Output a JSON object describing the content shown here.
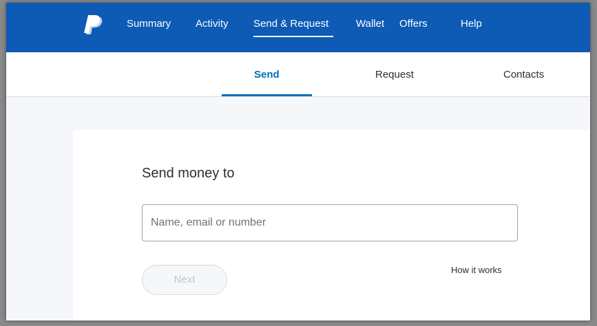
{
  "theme": {
    "nav_bg": "#0d5bb5",
    "accent": "#0070ba",
    "page_bg": "#f5f7fa"
  },
  "topnav": {
    "logo_icon": "paypal-logo-icon",
    "items": [
      {
        "label": "Summary"
      },
      {
        "label": "Activity"
      },
      {
        "label": "Send & Request",
        "active": true
      },
      {
        "label": "Wallet"
      },
      {
        "label": "Offers"
      },
      {
        "label": "Help"
      }
    ]
  },
  "subnav": {
    "tabs": [
      {
        "label": "Send",
        "active": true
      },
      {
        "label": "Request"
      },
      {
        "label": "Contacts"
      }
    ]
  },
  "send_form": {
    "title": "Send money to",
    "recipient_placeholder": "Name, email or number",
    "recipient_value": "",
    "next_label": "Next",
    "next_disabled": true,
    "help_link": "How it works"
  }
}
